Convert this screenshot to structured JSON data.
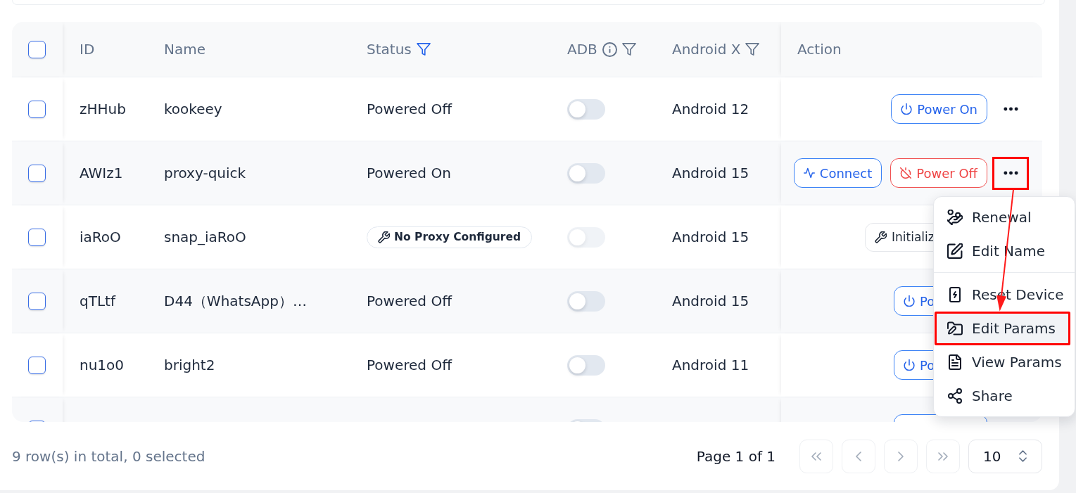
{
  "table": {
    "columns": [
      {
        "kind": "select",
        "checked": false
      },
      {
        "kind": "text",
        "label": "ID"
      },
      {
        "kind": "text",
        "label": "Name"
      },
      {
        "kind": "text",
        "label": "Status",
        "filter": {
          "active": true
        }
      },
      {
        "kind": "text",
        "label": "ADB",
        "info": true,
        "filter": {
          "active": false
        }
      },
      {
        "kind": "text",
        "label": "Android X",
        "filter": {
          "active": false
        }
      },
      {
        "kind": "action",
        "label": "Action"
      }
    ],
    "rows": [
      {
        "checked": false,
        "id": "zHHub",
        "name": "kookeey",
        "status": {
          "kind": "text",
          "label": "Powered Off"
        },
        "adb": {
          "on": false,
          "disabled": false
        },
        "android": "Android 12",
        "actions": [
          {
            "kind": "power_on",
            "label": "Power On"
          }
        ],
        "more": {
          "highlighted": false
        }
      },
      {
        "checked": false,
        "id": "AWIz1",
        "name": "proxy-quick",
        "status": {
          "kind": "text",
          "label": "Powered On"
        },
        "adb": {
          "on": false,
          "disabled": false
        },
        "android": "Android 15",
        "actions": [
          {
            "kind": "connect",
            "label": "Connect"
          },
          {
            "kind": "power_off",
            "label": "Power Off"
          }
        ],
        "more": {
          "highlighted": true,
          "menu": {
            "groups": [
              {
                "items": [
                  {
                    "kind": "renewal",
                    "label": "Renewal",
                    "selected": false,
                    "highlighted": false
                  },
                  {
                    "kind": "edit_name",
                    "label": "Edit Name",
                    "selected": false,
                    "highlighted": false
                  }
                ]
              },
              {
                "items": [
                  {
                    "kind": "reset_device",
                    "label": "Reset Device",
                    "selected": false,
                    "highlighted": false
                  },
                  {
                    "kind": "edit_params",
                    "label": "Edit Params",
                    "selected": true,
                    "highlighted": true
                  },
                  {
                    "kind": "view_params",
                    "label": "View Params",
                    "selected": false,
                    "highlighted": false
                  },
                  {
                    "kind": "share",
                    "label": "Share",
                    "selected": false,
                    "highlighted": false
                  }
                ]
              }
            ]
          }
        }
      },
      {
        "checked": false,
        "id": "iaRoO",
        "name": "snap_iaRoO",
        "status": {
          "kind": "badge",
          "label": "No Proxy Configured"
        },
        "adb": {
          "on": false,
          "disabled": true
        },
        "android": "Android 15",
        "actions": [
          {
            "kind": "initialize",
            "label": "Initializ"
          }
        ]
      },
      {
        "checked": false,
        "id": "qTLtf",
        "name": "D44（WhatsApp）…",
        "status": {
          "kind": "text",
          "label": "Powered Off"
        },
        "adb": {
          "on": false,
          "disabled": false
        },
        "android": "Android 15",
        "actions": [
          {
            "kind": "power_on",
            "label": "Po"
          }
        ]
      },
      {
        "checked": false,
        "id": "nu1o0",
        "name": "bright2",
        "status": {
          "kind": "text",
          "label": "Powered Off"
        },
        "adb": {
          "on": false,
          "disabled": false
        },
        "android": "Android 11",
        "actions": [
          {
            "kind": "power_on",
            "label": "Po"
          }
        ]
      },
      {
        "checked": false,
        "adb": {
          "on": false,
          "disabled": false
        },
        "actions": [
          {
            "kind": "power_on"
          }
        ]
      }
    ]
  },
  "annotations": [
    {
      "kind": "arrow"
    }
  ],
  "footer": {
    "summary": "9 row(s) in total, 0 selected",
    "page": "Page 1 of 1",
    "pager": [
      {
        "kind": "first",
        "disabled": true
      },
      {
        "kind": "prev",
        "disabled": true
      },
      {
        "kind": "next",
        "disabled": true
      },
      {
        "kind": "last",
        "disabled": true
      }
    ],
    "page_size": "10"
  }
}
